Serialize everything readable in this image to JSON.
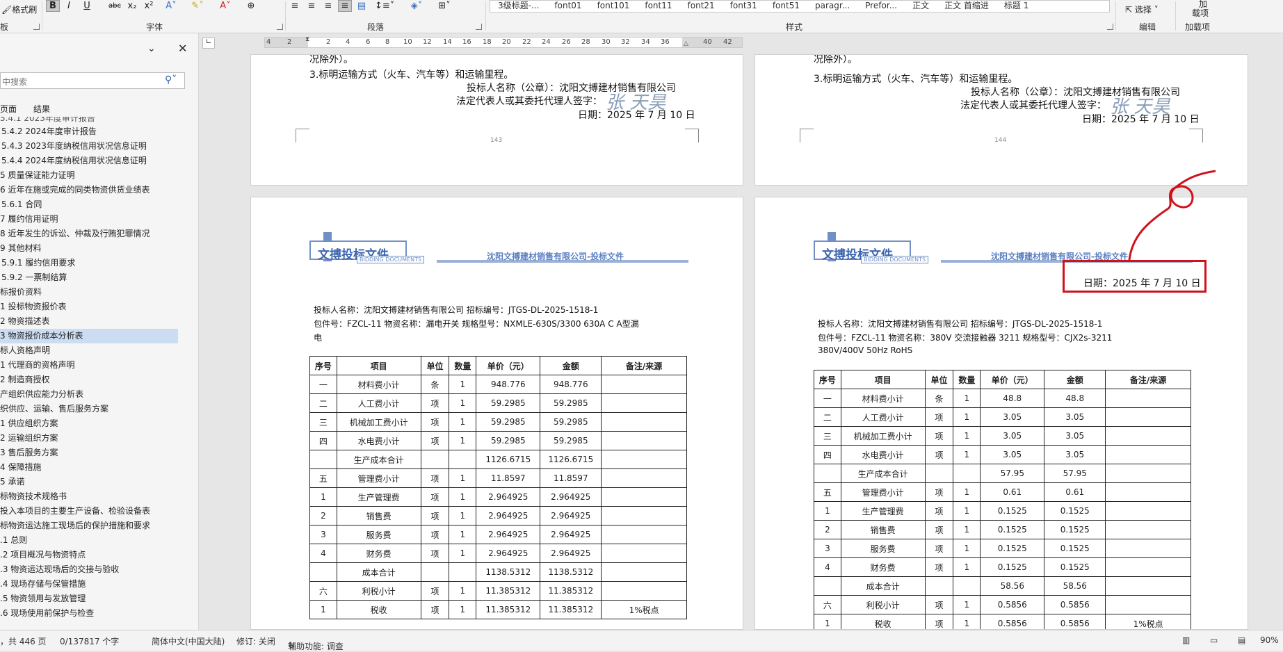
{
  "ribbon": {
    "format_painter": "格式刷",
    "font_buttons": [
      "B",
      "I",
      "U",
      "abc",
      "x₂",
      "x²"
    ],
    "font_group": "字体",
    "para_group": "段落",
    "styles_group": "样式",
    "edit_group": "编辑",
    "addin_group": "加载项",
    "styles": [
      "3级标题-...",
      "font01",
      "font101",
      "font11",
      "font21",
      "font31",
      "font51",
      "paragr...",
      "Prefor...",
      "正文",
      "正文 首缩进",
      "标题 1"
    ],
    "select_label": "选择 ˅",
    "addin_top": "加",
    "addin_label": "载项",
    "clipboard_group": "板"
  },
  "nav": {
    "search_placeholder": "中搜索",
    "tab_pages": "页面",
    "tab_results": "结果",
    "items": [
      "5.4.1 2023年度审计报告",
      "5.4.2 2024年度审计报告",
      "5.4.3 2023年度纳税信用状况信息证明",
      "5.4.4 2024年度纳税信用状况信息证明",
      "5 质量保证能力证明",
      "6 近年在施或完成的同类物资供货业绩表",
      "5.6.1 合同",
      "7 履约信用证明",
      "8 近年发生的诉讼、仲裁及行贿犯罪情况",
      "9 其他材料",
      "5.9.1 履约信用要求",
      "5.9.2 一票制结算",
      "标报价资料",
      "1 投标物资报价表",
      "2 物资描述表",
      "3 物资报价成本分析表",
      "标人资格声明",
      "1 代理商的资格声明",
      "2 制造商授权",
      "产组织供应能力分析表",
      "织供应、运输、售后服务方案",
      "1 供应组织方案",
      "2 运输组织方案",
      "3 售后服务方案",
      "4 保障措施",
      "5 承诺",
      "标物资技术规格书",
      "投入本项目的主要生产设备、检验设备表",
      "标物资运达施工现场后的保护措施和要求",
      ".1 总则",
      ".2 项目概况与物资特点",
      ".3 物资运达现场后的交接与验收",
      ".4 现场存储与保管措施",
      ".5 物资领用与发放管理",
      ".6 现场使用前保护与检查"
    ]
  },
  "ruler": [
    "4",
    "2",
    "2",
    "4",
    "6",
    "8",
    "10",
    "12",
    "14",
    "16",
    "18",
    "20",
    "22",
    "24",
    "26",
    "28",
    "30",
    "32",
    "34",
    "36",
    "40",
    "42"
  ],
  "pages": {
    "top_prev_text": "况除外）。",
    "top_line": "3.标明运输方式（火车、汽车等）和运输里程。",
    "top_bidder": "投标人名称（公章）：沈阳文搏建材销售有限公司",
    "top_rep": "法定代表人或其委托代理人签字：",
    "top_signature": "张 天昊",
    "top_date": "日期：2025 年 7 月 10 日",
    "page_num_left": "143",
    "page_num_right": "144",
    "logo_title": "文搏投标文件",
    "logo_sub": "BIDDING DOCUMENTS",
    "logo_cn": "沈阳文搏建材销售有限公司-投标文件",
    "right_date": "日期：2025 年 7 月 10 日"
  },
  "left_doc": {
    "line1": "投标人名称：沈阳文搏建材销售有限公司   招标编号：JTGS-DL-2025-1518-1",
    "line2": "包件号：FZCL-11   物资名称：漏电开关     规格型号：NXMLE-630S/3300 630A C A型漏",
    "line3": "电",
    "header": [
      "序号",
      "项目",
      "单位",
      "数量",
      "单价（元）",
      "金额",
      "备注/来源"
    ],
    "rows": [
      [
        "一",
        "材料费小计",
        "条",
        "1",
        "948.776",
        "948.776",
        ""
      ],
      [
        "二",
        "人工费小计",
        "项",
        "1",
        "59.2985",
        "59.2985",
        ""
      ],
      [
        "三",
        "机械加工费小计",
        "项",
        "1",
        "59.2985",
        "59.2985",
        ""
      ],
      [
        "四",
        "水电费小计",
        "项",
        "1",
        "59.2985",
        "59.2985",
        ""
      ],
      [
        "",
        "生产成本合计",
        "",
        "",
        "1126.6715",
        "1126.6715",
        ""
      ],
      [
        "五",
        "管理费小计",
        "项",
        "1",
        "11.8597",
        "11.8597",
        ""
      ],
      [
        "1",
        "生产管理费",
        "项",
        "1",
        "2.964925",
        "2.964925",
        ""
      ],
      [
        "2",
        "销售费",
        "项",
        "1",
        "2.964925",
        "2.964925",
        ""
      ],
      [
        "3",
        "服务费",
        "项",
        "1",
        "2.964925",
        "2.964925",
        ""
      ],
      [
        "4",
        "财务费",
        "项",
        "1",
        "2.964925",
        "2.964925",
        ""
      ],
      [
        "",
        "成本合计",
        "",
        "",
        "1138.5312",
        "1138.5312",
        ""
      ],
      [
        "六",
        "利税小计",
        "项",
        "1",
        "11.385312",
        "11.385312",
        ""
      ],
      [
        "1",
        "税收",
        "项",
        "1",
        "11.385312",
        "11.385312",
        "1%税点"
      ]
    ]
  },
  "right_doc": {
    "line1": "投标人名称：沈阳文搏建材销售有限公司   招标编号：JTGS-DL-2025-1518-1",
    "line2": "包件号：FZCL-11   物资名称：380V 交流接触器 3211     规格型号：CJX2s-3211",
    "line3": "380V/400V 50Hz RoHS",
    "header": [
      "序号",
      "项目",
      "单位",
      "数量",
      "单价（元）",
      "金额",
      "备注/来源"
    ],
    "rows": [
      [
        "一",
        "材料费小计",
        "条",
        "1",
        "48.8",
        "48.8",
        ""
      ],
      [
        "二",
        "人工费小计",
        "项",
        "1",
        "3.05",
        "3.05",
        ""
      ],
      [
        "三",
        "机械加工费小计",
        "项",
        "1",
        "3.05",
        "3.05",
        ""
      ],
      [
        "四",
        "水电费小计",
        "项",
        "1",
        "3.05",
        "3.05",
        ""
      ],
      [
        "",
        "生产成本合计",
        "",
        "",
        "57.95",
        "57.95",
        ""
      ],
      [
        "五",
        "管理费小计",
        "项",
        "1",
        "0.61",
        "0.61",
        ""
      ],
      [
        "1",
        "生产管理费",
        "项",
        "1",
        "0.1525",
        "0.1525",
        ""
      ],
      [
        "2",
        "销售费",
        "项",
        "1",
        "0.1525",
        "0.1525",
        ""
      ],
      [
        "3",
        "服务费",
        "项",
        "1",
        "0.1525",
        "0.1525",
        ""
      ],
      [
        "4",
        "财务费",
        "项",
        "1",
        "0.1525",
        "0.1525",
        ""
      ],
      [
        "",
        "成本合计",
        "",
        "",
        "58.56",
        "58.56",
        ""
      ],
      [
        "六",
        "利税小计",
        "项",
        "1",
        "0.5856",
        "0.5856",
        ""
      ],
      [
        "1",
        "税收",
        "项",
        "1",
        "0.5856",
        "0.5856",
        "1%税点"
      ]
    ]
  },
  "status": {
    "pages": "，共 446 页",
    "words": "0/137817 个字",
    "lang": "简体中文(中国大陆)",
    "track": "修订: 关闭",
    "access": "辅助功能: 调查",
    "zoom": "90%"
  },
  "colors": {
    "annotation": "#d0121b",
    "logo_blue": "#3d65ad"
  }
}
